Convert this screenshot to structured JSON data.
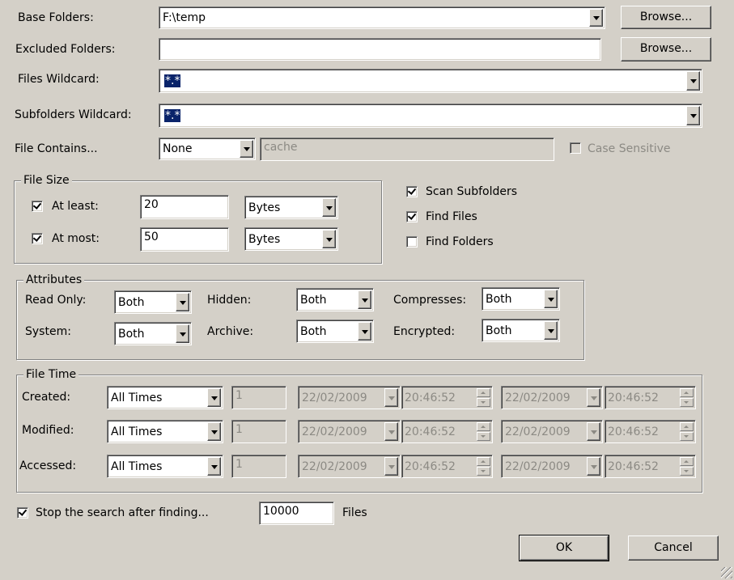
{
  "base_folders": {
    "label": "Base Folders:",
    "value": "F:\\temp",
    "browse": "Browse..."
  },
  "excluded_folders": {
    "label": "Excluded Folders:",
    "value": "",
    "browse": "Browse..."
  },
  "files_wildcard": {
    "label": "Files Wildcard:",
    "value": "*.*"
  },
  "subfolders_wildcard": {
    "label": "Subfolders Wildcard:",
    "value": "*.*"
  },
  "file_contains": {
    "label": "File Contains...",
    "mode": "None",
    "text": "cache",
    "case_sensitive": "Case Sensitive",
    "case_sensitive_checked": false
  },
  "file_size": {
    "title": "File Size",
    "at_least": {
      "label": "At least:",
      "checked": true,
      "value": "20",
      "unit": "Bytes"
    },
    "at_most": {
      "label": "At most:",
      "checked": true,
      "value": "50",
      "unit": "Bytes"
    }
  },
  "options": {
    "scan_subfolders": {
      "label": "Scan Subfolders",
      "checked": true
    },
    "find_files": {
      "label": "Find Files",
      "checked": true
    },
    "find_folders": {
      "label": "Find Folders",
      "checked": false
    }
  },
  "attributes": {
    "title": "Attributes",
    "read_only": {
      "label": "Read Only:",
      "value": "Both"
    },
    "hidden": {
      "label": "Hidden:",
      "value": "Both"
    },
    "compresses": {
      "label": "Compresses:",
      "value": "Both"
    },
    "system": {
      "label": "System:",
      "value": "Both"
    },
    "archive": {
      "label": "Archive:",
      "value": "Both"
    },
    "encrypted": {
      "label": "Encrypted:",
      "value": "Both"
    }
  },
  "file_time": {
    "title": "File Time",
    "rows": [
      {
        "label": "Created:",
        "mode": "All Times",
        "count": "1",
        "date1": "22/02/2009",
        "time1": "20:46:52",
        "date2": "22/02/2009",
        "time2": "20:46:52"
      },
      {
        "label": "Modified:",
        "mode": "All Times",
        "count": "1",
        "date1": "22/02/2009",
        "time1": "20:46:52",
        "date2": "22/02/2009",
        "time2": "20:46:52"
      },
      {
        "label": "Accessed:",
        "mode": "All Times",
        "count": "1",
        "date1": "22/02/2009",
        "time1": "20:46:52",
        "date2": "22/02/2009",
        "time2": "20:46:52"
      }
    ]
  },
  "stop_search": {
    "label": "Stop the search after finding...",
    "checked": true,
    "value": "10000",
    "unit": "Files"
  },
  "buttons": {
    "ok": "OK",
    "cancel": "Cancel"
  }
}
